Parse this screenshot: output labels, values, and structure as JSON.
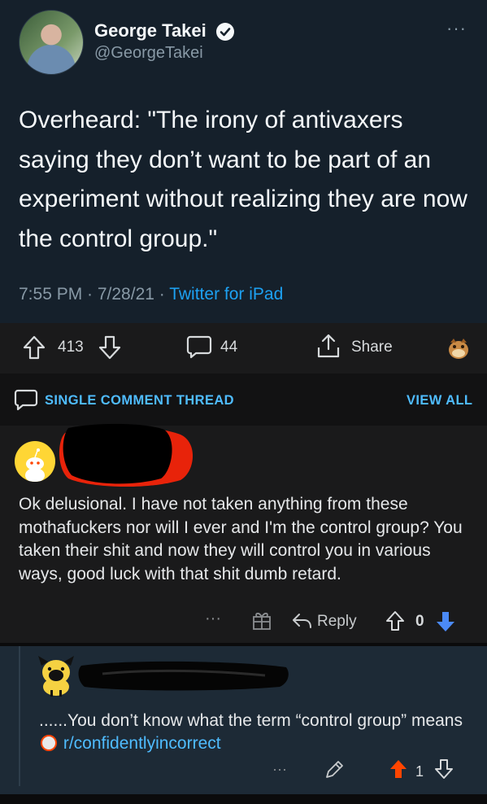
{
  "tweet": {
    "author_name": "George Takei",
    "author_handle": "@GeorgeTakei",
    "text": "Overheard: \"The irony of antivaxers saying they don’t want to be part of an experiment without realizing they are now the control group.\"",
    "timestamp": "7:55 PM · 7/28/21 · ",
    "source": "Twitter for iPad",
    "more_icon": "···"
  },
  "post_actions": {
    "upvotes": "413",
    "comments": "44",
    "share_label": "Share"
  },
  "thread": {
    "title": "SINGLE COMMENT THREAD",
    "view_all": "VIEW ALL"
  },
  "comment1": {
    "text": "Ok delusional. I have not taken anything from these mothafuckers nor will I ever and I'm the control group? You taken their shit and now they will control you in various ways, good luck with that shit dumb retard.",
    "more": "···",
    "reply_label": "Reply",
    "score": "0"
  },
  "comment2": {
    "text_before": "......You don’t know what the term “control group” means ",
    "subreddit": "r/confidentlyincorrect",
    "more": "···",
    "score": "1"
  },
  "colors": {
    "twitter_bg": "#15202b",
    "reddit_bg": "#1a1a1b",
    "link_blue": "#4fbcff",
    "twitter_blue": "#1da1f2",
    "upvote_orange": "#ff4500",
    "downvote_blue": "#4b8af7"
  },
  "icons": [
    "verified-icon",
    "upvote-icon",
    "downvote-icon",
    "comment-icon",
    "share-icon",
    "gift-icon",
    "reply-icon",
    "pencil-icon",
    "snoo-avatar",
    "chat-bubble-icon"
  ]
}
